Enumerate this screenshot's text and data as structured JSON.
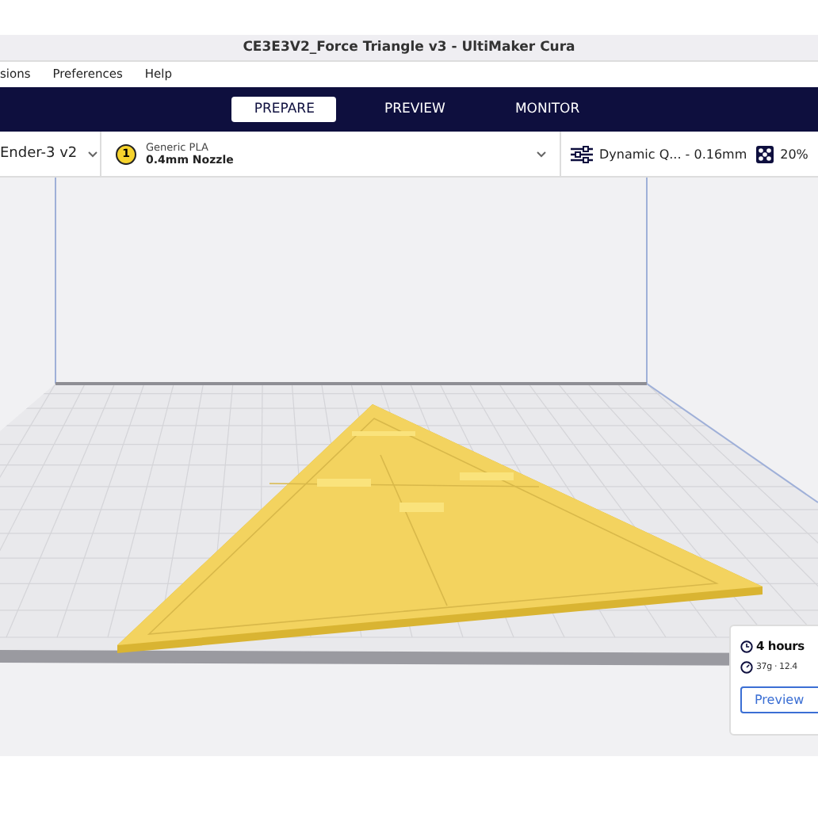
{
  "window": {
    "title": "CE3E3V2_Force Triangle v3 - UltiMaker Cura"
  },
  "menu": [
    "sions",
    "Preferences",
    "Help"
  ],
  "tabs": [
    {
      "label": "PREPARE",
      "selected": true
    },
    {
      "label": "PREVIEW",
      "selected": false
    },
    {
      "label": "MONITOR",
      "selected": false
    }
  ],
  "printer": {
    "name": "Ender-3 v2"
  },
  "extruder": {
    "number": "1",
    "material": "Generic PLA",
    "nozzle": "0.4mm Nozzle"
  },
  "profile": {
    "label": "Dynamic Q... - 0.16mm",
    "infill": "20%"
  },
  "estimate": {
    "time": "4 hours",
    "material": "37g · 12.4",
    "button": "Preview"
  }
}
